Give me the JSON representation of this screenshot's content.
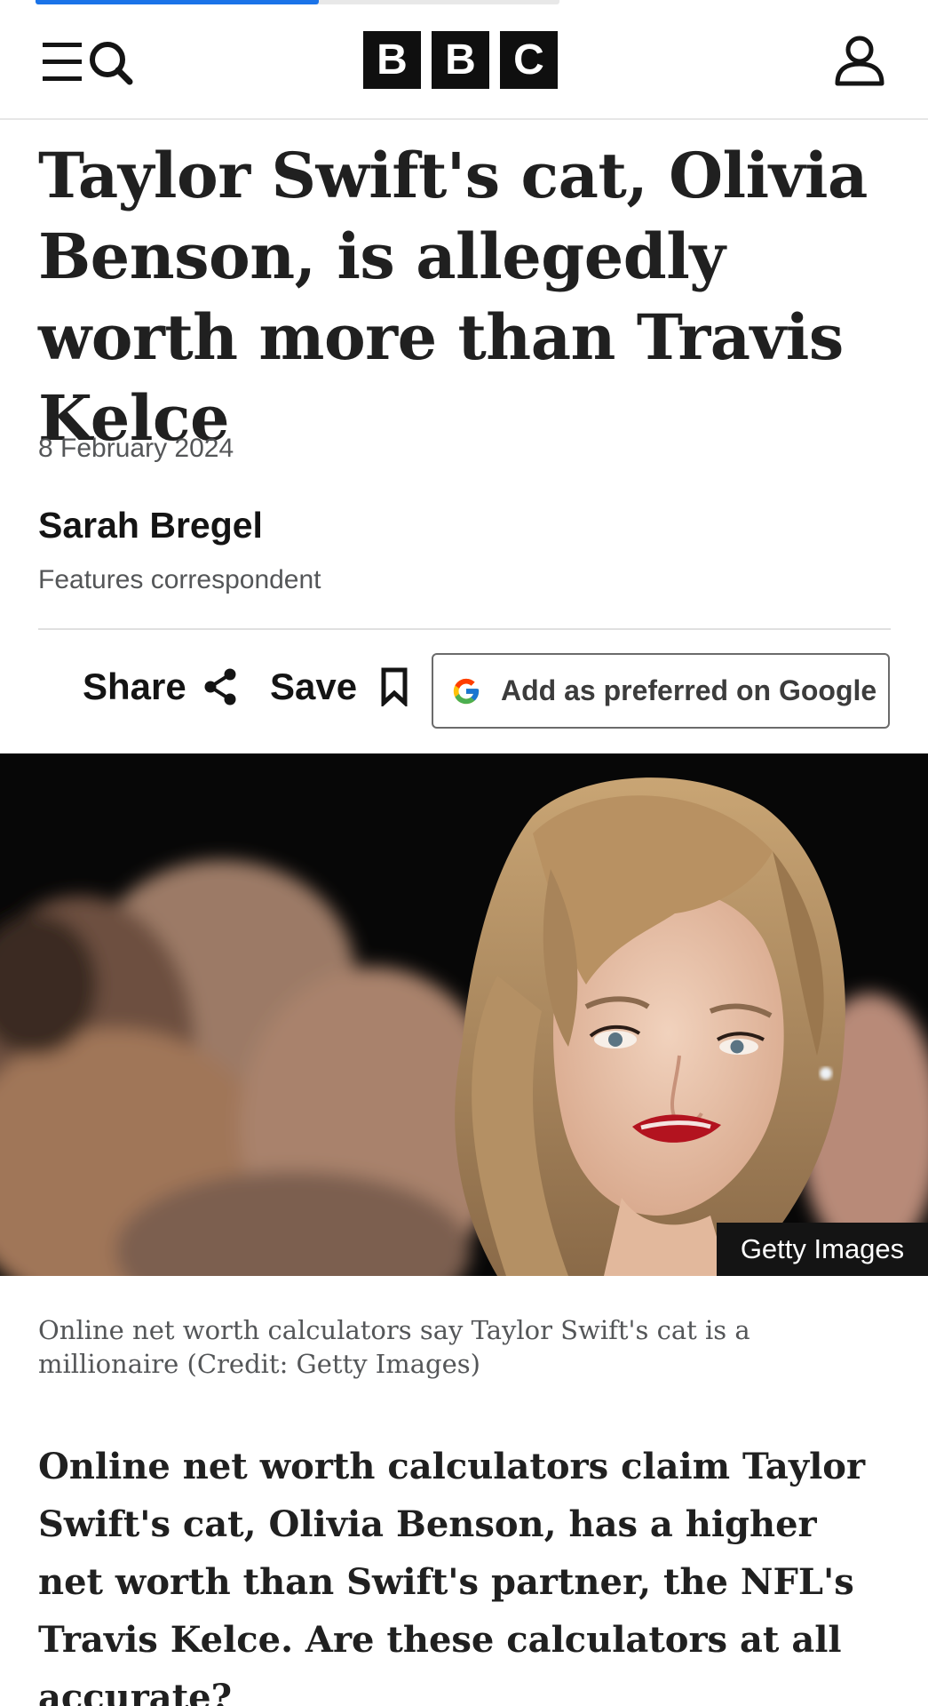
{
  "header": {
    "menu_search_icon": "menu-search-icon",
    "brand_letters": [
      "B",
      "B",
      "C"
    ],
    "account_icon": "account-icon",
    "reading_progress": 0.54
  },
  "article": {
    "headline": "Taylor Swift's cat, Olivia Benson, is allegedly worth more than Travis Kelce",
    "date": "8 February 2024",
    "author": "Sarah Bregel",
    "author_role": "Features correspondent",
    "actions": {
      "share_label": "Share",
      "share_icon": "share-icon",
      "save_label": "Save",
      "save_icon": "bookmark-icon",
      "google_label": "Add as preferred on Google",
      "google_icon": "google-g-icon"
    },
    "image": {
      "credit": "Getty Images",
      "caption": "Online net worth calculators say Taylor Swift's cat is a millionaire (Credit: Getty Images)"
    },
    "standfirst": "Online net worth calculators claim Taylor Swift's cat, Olivia Benson, has a higher net worth than Swift's partner, the NFL's Travis Kelce. Are these calculators at all accurate?"
  },
  "colors": {
    "progress": "#1a73e8",
    "brand_block": "#0f0f0f",
    "text": "#141414",
    "muted": "#545658"
  }
}
